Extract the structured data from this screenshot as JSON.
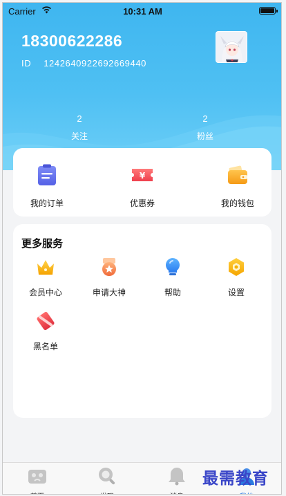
{
  "status_bar": {
    "carrier": "Carrier",
    "time": "10:31 AM"
  },
  "profile": {
    "phone": "18300622286",
    "id_label": "ID",
    "id_value": "1242640922692669440",
    "avatar": "anime-avatar"
  },
  "stats": [
    {
      "count": "2",
      "label": "关注"
    },
    {
      "count": "2",
      "label": "粉丝"
    }
  ],
  "quick_actions": [
    {
      "label": "我的订单",
      "icon": "clipboard-icon"
    },
    {
      "label": "优惠券",
      "icon": "coupon-icon"
    },
    {
      "label": "我的钱包",
      "icon": "wallet-icon"
    }
  ],
  "more_services": {
    "title": "更多服务",
    "items": [
      {
        "label": "会员中心",
        "icon": "crown-icon"
      },
      {
        "label": "申请大神",
        "icon": "medal-icon"
      },
      {
        "label": "帮助",
        "icon": "lightbulb-icon"
      },
      {
        "label": "设置",
        "icon": "hexagon-gear-icon"
      },
      {
        "label": "黑名单",
        "icon": "blacklist-icon"
      }
    ]
  },
  "tabbar": [
    {
      "label": "首页",
      "icon": "home-icon",
      "active": false
    },
    {
      "label": "发现",
      "icon": "discover-icon",
      "active": false
    },
    {
      "label": "消息",
      "icon": "bell-icon",
      "active": false
    },
    {
      "label": "我的",
      "icon": "profile-icon",
      "active": true
    }
  ],
  "watermark": "最需教育",
  "colors": {
    "header_blue": "#43b9f1",
    "accent_blue": "#2b7be0",
    "card_bg": "#ffffff",
    "page_bg": "#f3f4f6"
  }
}
